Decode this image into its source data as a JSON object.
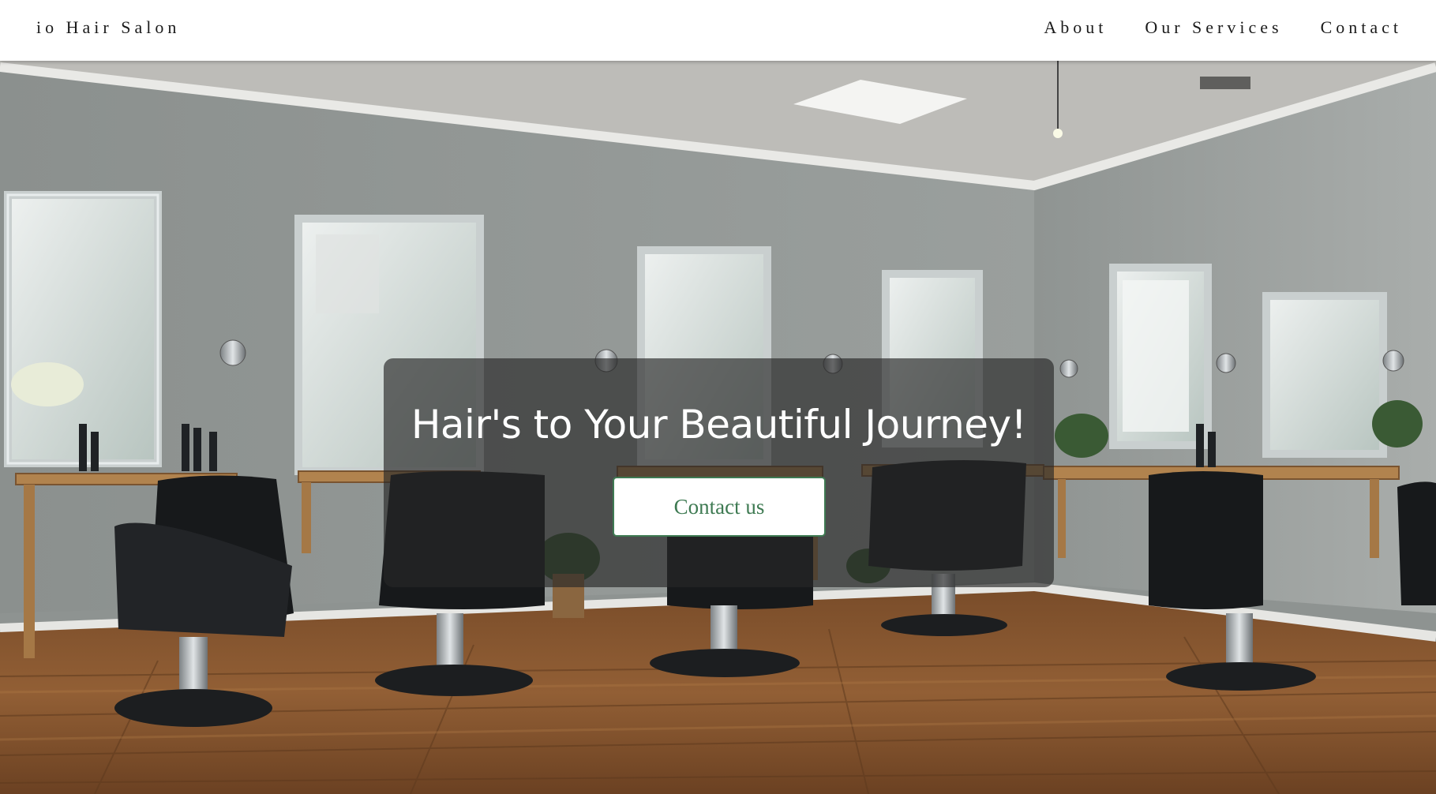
{
  "nav": {
    "brand": "io Hair Salon",
    "links": [
      {
        "label": "About"
      },
      {
        "label": "Our Services"
      },
      {
        "label": "Contact"
      }
    ]
  },
  "hero": {
    "headline": "Hair's to Your Beautiful Journey!",
    "cta_label": "Contact us",
    "background_image": "hair-salon-interior-photo"
  },
  "colors": {
    "nav_background": "#ffffff",
    "text_dark": "#1b1b1b",
    "overlay": "rgba(40,40,40,0.66)",
    "cta_accent": "#3e7a52",
    "headline": "#ffffff"
  }
}
